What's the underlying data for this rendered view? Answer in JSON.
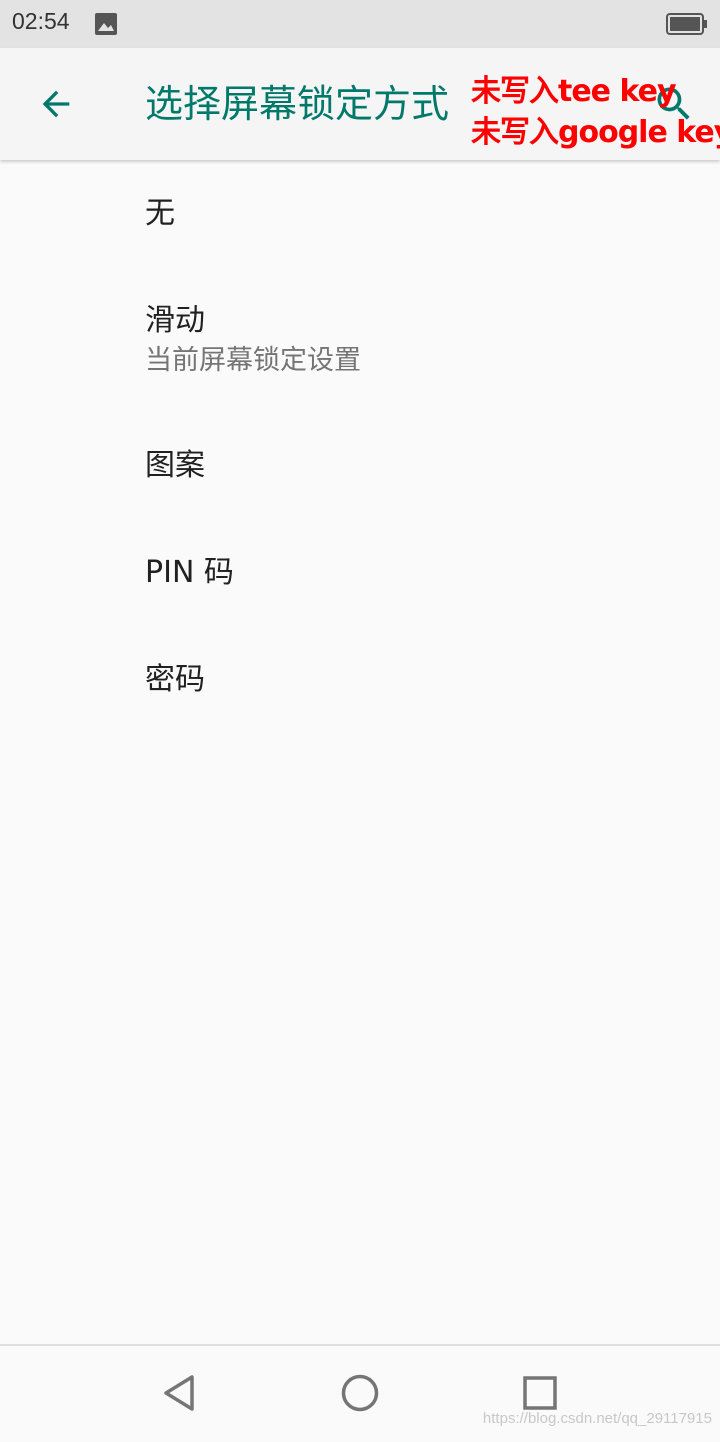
{
  "status_bar": {
    "time": "02:54",
    "notification_icon": "image-icon",
    "battery_icon": "battery-icon"
  },
  "app_bar": {
    "back_icon": "arrow-left-icon",
    "title": "选择屏幕锁定方式",
    "search_icon": "search-icon"
  },
  "overlay": {
    "line1": "未写入tee key",
    "line2": "未写入google key"
  },
  "lock_options": [
    {
      "title": "无"
    },
    {
      "title": "滑动",
      "summary": "当前屏幕锁定设置"
    },
    {
      "title": "图案"
    },
    {
      "title": "PIN 码"
    },
    {
      "title": "密码"
    }
  ],
  "nav_bar": {
    "back_icon": "triangle-back-icon",
    "home_icon": "circle-home-icon",
    "recents_icon": "square-recents-icon"
  },
  "watermark": "https://blog.csdn.net/qq_29117915",
  "colors": {
    "accent": "#00796b",
    "overlay_text": "#ff0000",
    "status_bar": "#e3e3e3",
    "app_bar": "#f5f5f5",
    "background": "#fafafa"
  }
}
